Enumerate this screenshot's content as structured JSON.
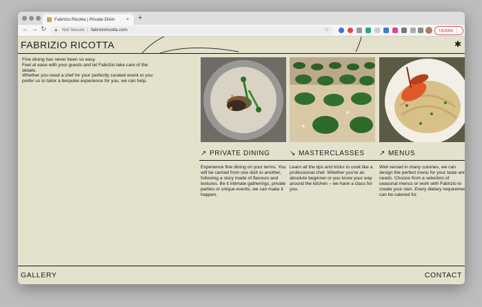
{
  "browser": {
    "tab_title": "Fabrizio Ricotta | Private Dinin",
    "tab_close": "×",
    "new_tab": "+",
    "omnibox": {
      "security_label": "Not Secure",
      "separator": "|",
      "url": "fabrizioricotta.com"
    },
    "update_label": "Update",
    "update_menu": "⋮"
  },
  "site": {
    "brand": "FABRIZIO RICOTTA",
    "asterisk": "✱",
    "intro_lines": [
      "Fine dining has never been so easy.",
      "Feel at ease with your guests and let Fabrizio take care of the details.",
      "Whether you need a chef for your perfectly curated event or you prefer us to tailor a bespoke experience for you, we can help."
    ],
    "cards": [
      {
        "title": "PRIVATE DINING",
        "arrow": "↗",
        "description": "Experience fine dining on your terms. You will be carried from one dish to another, following a story made of flavours and textures. Be it intimate gatherings, private parties or unique events, we can make it happen."
      },
      {
        "title": "MASTERCLASSES",
        "arrow": "↘",
        "description": "Learn all the tips and tricks to cook like a professional chef. Whether you're an absolute beginner or you know your way around the kitchen – we have a class for you."
      },
      {
        "title": "MENUS",
        "arrow": "↗",
        "description": "Well versed in many cuisines, we can design the perfect menu for your taste and needs. Choose from a selection of seasonal menus or work with Fabrizio to create your own. Every dietary requirement can be catered for."
      }
    ],
    "footer": {
      "left": "GALLERY",
      "right": "CONTACT"
    }
  },
  "colors": {
    "page_bg": "#e4e1cd",
    "text": "#1a1a1a",
    "update_accent": "#d9534f"
  },
  "icons": [
    "back-arrow-icon",
    "forward-arrow-icon",
    "reload-icon",
    "warning-icon",
    "star-icon",
    "extension-icon",
    "profile-avatar-icon"
  ]
}
